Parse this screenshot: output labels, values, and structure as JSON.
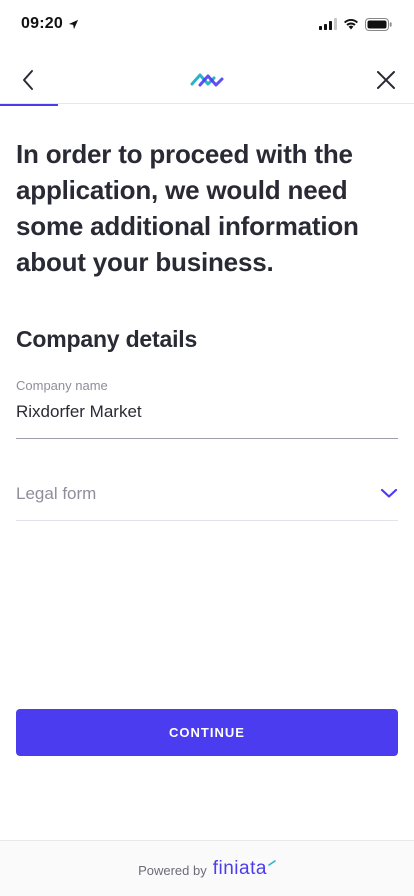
{
  "status_bar": {
    "time": "09:20",
    "icons": [
      "location-arrow-icon",
      "cellular-signal-icon",
      "wifi-icon",
      "battery-icon"
    ]
  },
  "nav": {
    "back_icon": "chevron-left-icon",
    "logo": "finiata-infinity-logo",
    "close_icon": "close-icon",
    "progress": 0.14
  },
  "headline": "In order to proceed with the application, we would need some additional information about your business.",
  "section_title": "Company details",
  "company_name": {
    "label": "Company name",
    "value": "Rixdorfer Market"
  },
  "legal_form": {
    "placeholder": "Legal form",
    "icon": "chevron-down-icon"
  },
  "continue_label": "CONTINUE",
  "footer": {
    "powered_by": "Powered by",
    "brand": "finiata"
  },
  "colors": {
    "accent": "#4b3cf0",
    "text": "#2a2a35",
    "muted": "#8e8f9b",
    "logo_teal": "#2bb3c8"
  }
}
